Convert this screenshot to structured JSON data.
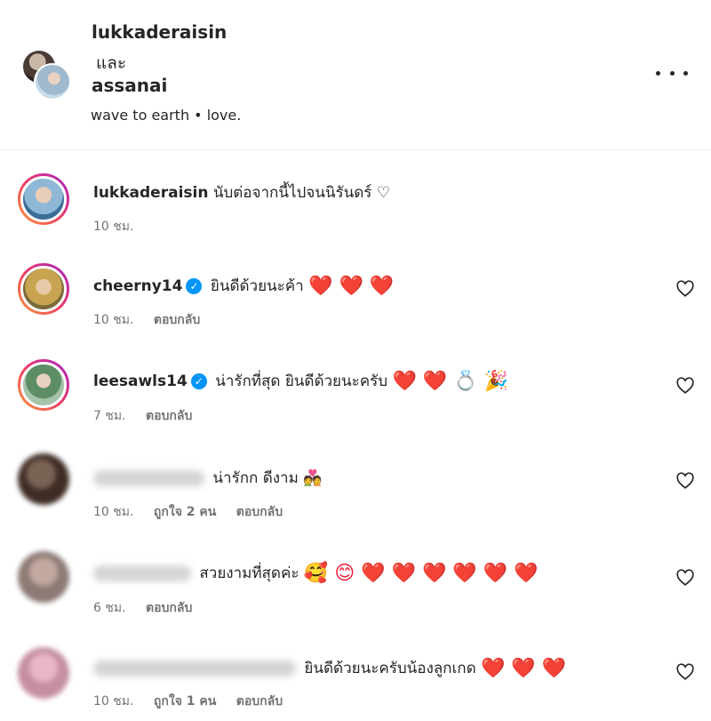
{
  "header": {
    "user1": "lukkaderaisin",
    "conjunction": "และ",
    "user2": "assanai",
    "song": "wave to earth • love."
  },
  "comments": [
    {
      "username": "lukkaderaisin",
      "text": "นับต่อจากนี้ไปจนนิรันดร์ ♡",
      "time": "10 ชม.",
      "reply": "",
      "likes": ""
    },
    {
      "username": "cheerny14",
      "verified": true,
      "text": "ยินดีด้วยนะค้า",
      "hearts": "❤️ ❤️ ❤️",
      "time": "10 ชม.",
      "reply": "ตอบกลับ"
    },
    {
      "username": "leesawls14",
      "verified": true,
      "text": "น่ารักที่สุด ยินดีด้วยนะครับ",
      "hearts": "❤️ ❤️ 💍 🎉",
      "time": "7 ชม.",
      "reply": "ตอบกลับ"
    },
    {
      "username": "",
      "text": "น่ารักก ดีงาม",
      "emoji": "💑",
      "time": "10 ชม.",
      "likes": "ถูกใจ 2 คน",
      "reply": "ตอบกลับ"
    },
    {
      "username": "",
      "text": "สวยงามที่สุดค่ะ",
      "emoji": "🥰 😊 ❤️ ❤️ ❤️ ❤️ ❤️ ❤️",
      "time": "6 ชม.",
      "reply": "ตอบกลับ"
    },
    {
      "username": "",
      "text": "ยินดีด้วยนะครับน้องลูกเกด",
      "hearts": "❤️ ❤️ ❤️",
      "time": "10 ชม.",
      "likes": "ถูกใจ 1 คน",
      "reply": "ตอบกลับ"
    }
  ],
  "icons": {
    "more": "more-horizontal-icon",
    "like": "heart-outline-icon",
    "verified": "verified-badge-icon"
  },
  "colors": {
    "verified": "#0095f6",
    "heart": "#ed1c3b",
    "meta": "#737373"
  }
}
